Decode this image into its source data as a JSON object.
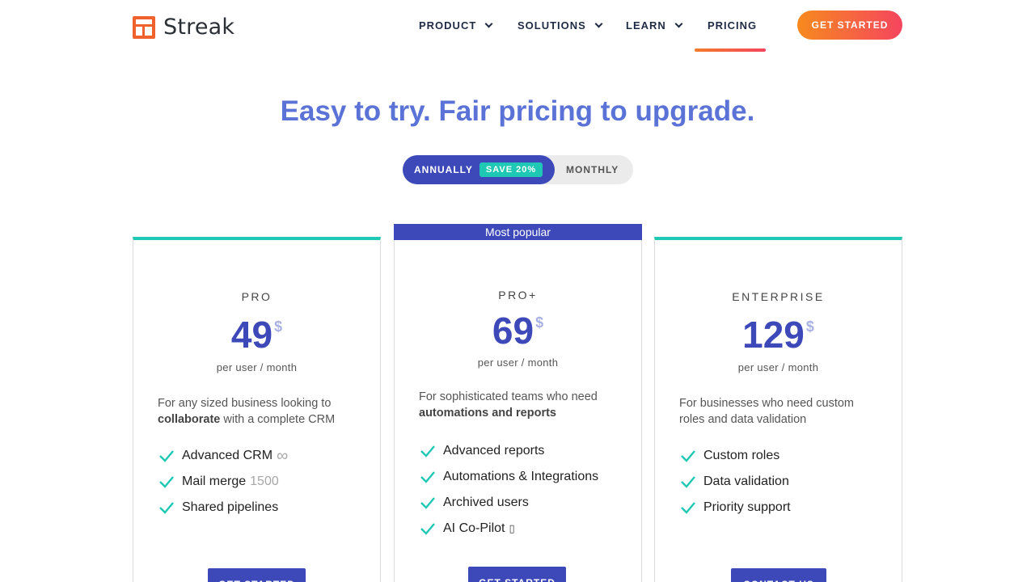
{
  "brand": {
    "name": "Streak"
  },
  "nav": {
    "items": [
      {
        "label": "PRODUCT"
      },
      {
        "label": "SOLUTIONS"
      },
      {
        "label": "LEARN"
      },
      {
        "label": "PRICING"
      }
    ],
    "active": "PRICING",
    "cta_label": "GET STARTED"
  },
  "hero": {
    "headline": "Easy to try. Fair pricing to upgrade."
  },
  "billing_toggle": {
    "annually_label": "ANNUALLY",
    "save_badge": "SAVE 20%",
    "monthly_label": "MONTHLY",
    "selected": "ANNUALLY"
  },
  "plans": [
    {
      "name": "PRO",
      "price": "49",
      "currency": "$",
      "period": "per user / month",
      "desc_before": "For any sized business looking to",
      "desc_bold": "collaborate",
      "desc_after": "with a complete CRM",
      "features": [
        {
          "label": "Advanced CRM",
          "extra": "∞"
        },
        {
          "label": "Mail merge",
          "extra": "1500"
        },
        {
          "label": "Shared pipelines",
          "extra": ""
        }
      ],
      "button": "GET STARTED"
    },
    {
      "name": "PRO+",
      "badge": "Most popular",
      "price": "69",
      "currency": "$",
      "period": "per user / month",
      "desc_before": "For sophisticated teams who need",
      "desc_bold": "automations and reports",
      "desc_after": "",
      "features": [
        {
          "label": "Advanced reports",
          "extra": ""
        },
        {
          "label": "Automations & Integrations",
          "extra": ""
        },
        {
          "label": "Archived users",
          "extra": ""
        },
        {
          "label": "AI Co-Pilot",
          "extra": "▯"
        }
      ],
      "button": "GET STARTED"
    },
    {
      "name": "ENTERPRISE",
      "price": "129",
      "currency": "$",
      "period": "per user / month",
      "desc_before": "For businesses who need custom roles and data validation",
      "desc_bold": "",
      "desc_after": "",
      "features": [
        {
          "label": "Custom roles",
          "extra": ""
        },
        {
          "label": "Data validation",
          "extra": ""
        },
        {
          "label": "Priority support",
          "extra": ""
        }
      ],
      "button": "CONTACT US"
    }
  ],
  "colors": {
    "brand_orange": "#f0612d",
    "primary_blue": "#3d49b8",
    "headline_blue": "#5b72d6",
    "teal": "#1ec8b4",
    "cta_gradient_start": "#f78a1e",
    "cta_gradient_end": "#f5455e"
  }
}
